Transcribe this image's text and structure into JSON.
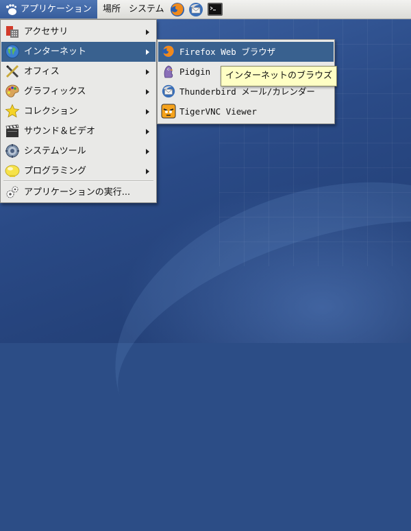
{
  "panel": {
    "applications_label": "アプリケーション",
    "places_label": "場所",
    "system_label": "システム",
    "launchers": [
      "firefox-icon",
      "thunderbird-icon",
      "terminal-icon"
    ]
  },
  "main_menu": {
    "items": [
      {
        "label": "アクセサリ",
        "icon": "accessories-icon",
        "submenu": true
      },
      {
        "label": "インターネット",
        "icon": "globe-icon",
        "submenu": true,
        "active": true
      },
      {
        "label": "オフィス",
        "icon": "office-icon",
        "submenu": true
      },
      {
        "label": "グラフィックス",
        "icon": "palette-icon",
        "submenu": true
      },
      {
        "label": "コレクション",
        "icon": "star-icon",
        "submenu": true
      },
      {
        "label": "サウンド＆ビデオ",
        "icon": "clapperboard-icon",
        "submenu": true
      },
      {
        "label": "システムツール",
        "icon": "gear-icon",
        "submenu": true
      },
      {
        "label": "プログラミング",
        "icon": "lightbulb-icon",
        "submenu": true
      }
    ],
    "run_label": "アプリケーションの実行..."
  },
  "internet_submenu": {
    "items": [
      {
        "label": "Firefox Web ブラウザ",
        "icon": "firefox-icon",
        "active": true
      },
      {
        "label": "Pidgin",
        "icon": "pidgin-icon"
      },
      {
        "label": "Thunderbird メール/カレンダー",
        "icon": "thunderbird-icon"
      },
      {
        "label": "TigerVNC Viewer",
        "icon": "tigervnc-icon"
      }
    ]
  },
  "tooltip": {
    "text": "インターネットのブラウズ"
  },
  "colors": {
    "highlight": "#39618f",
    "menu_bg": "#e9e9e7",
    "tooltip_bg": "#ffffc4",
    "desktop": "#2c4d86"
  }
}
